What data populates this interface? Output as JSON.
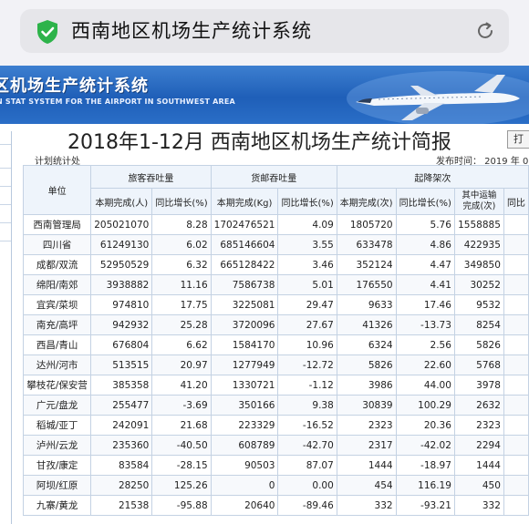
{
  "browser": {
    "address_title": "西南地区机场生产统计系统"
  },
  "banner": {
    "title": "区机场生产统计系统",
    "subtitle": "N STAT SYSTEM FOR THE AIRPORT IN SOUTHWEST AREA"
  },
  "report": {
    "title": "2018年1-12月 西南地区机场生产统计简报",
    "print_label": "打",
    "department": "计划统计处",
    "issue_date": "发布时间： 2019 年 01"
  },
  "table": {
    "unit_header": "单位",
    "groups": [
      "旅客吞吐量",
      "货邮吞吐量",
      "起降架次"
    ],
    "sub_headers": [
      "本期完成(人)",
      "同比增长(%)",
      "本期完成(Kg)",
      "同比增长(%)",
      "本期完成(次)",
      "同比增长(%)",
      "其中运输完成(次)",
      "同比"
    ],
    "rows": [
      [
        "西南管理局",
        "205021070",
        "8.28",
        "1702476521",
        "4.09",
        "1805720",
        "5.76",
        "1558885",
        ""
      ],
      [
        "四川省",
        "61249130",
        "6.02",
        "685146604",
        "3.55",
        "633478",
        "4.86",
        "422935",
        ""
      ],
      [
        "成都/双流",
        "52950529",
        "6.32",
        "665128422",
        "3.46",
        "352124",
        "4.47",
        "349850",
        ""
      ],
      [
        "绵阳/南郊",
        "3938882",
        "11.16",
        "7586738",
        "5.01",
        "176550",
        "4.41",
        "30252",
        ""
      ],
      [
        "宜宾/菜坝",
        "974810",
        "17.75",
        "3225081",
        "29.47",
        "9633",
        "17.46",
        "9532",
        ""
      ],
      [
        "南充/高坪",
        "942932",
        "25.28",
        "3720096",
        "27.67",
        "41326",
        "-13.73",
        "8254",
        ""
      ],
      [
        "西昌/青山",
        "676804",
        "6.62",
        "1584170",
        "10.96",
        "6324",
        "2.56",
        "5826",
        ""
      ],
      [
        "达州/河市",
        "513515",
        "20.97",
        "1277949",
        "-12.72",
        "5826",
        "22.60",
        "5768",
        ""
      ],
      [
        "攀枝花/保安营",
        "385358",
        "41.20",
        "1330721",
        "-1.12",
        "3986",
        "44.00",
        "3978",
        ""
      ],
      [
        "广元/盘龙",
        "255477",
        "-3.69",
        "350166",
        "9.38",
        "30839",
        "100.29",
        "2632",
        ""
      ],
      [
        "稻城/亚丁",
        "242091",
        "21.68",
        "223329",
        "-16.52",
        "2323",
        "20.36",
        "2323",
        ""
      ],
      [
        "泸州/云龙",
        "235360",
        "-40.50",
        "608789",
        "-42.70",
        "2317",
        "-42.02",
        "2294",
        ""
      ],
      [
        "甘孜/康定",
        "83584",
        "-28.15",
        "90503",
        "87.07",
        "1444",
        "-18.97",
        "1444",
        ""
      ],
      [
        "阿坝/红原",
        "28250",
        "125.26",
        "0",
        "0.00",
        "454",
        "116.19",
        "450",
        ""
      ],
      [
        "九寨/黄龙",
        "21538",
        "-95.88",
        "20640",
        "-89.46",
        "332",
        "-93.21",
        "332",
        ""
      ]
    ]
  },
  "colors": {
    "banner_blue": "#1f5fb8",
    "header_bg": "#eef4fb",
    "grid_border": "#c4d2e3",
    "secure_green": "#2db34a"
  }
}
